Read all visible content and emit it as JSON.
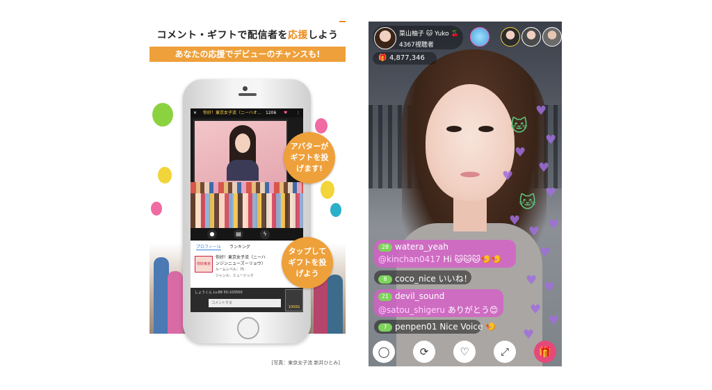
{
  "left_panel": {
    "headline_prefix": "コメント・ギフトで配信者を",
    "headline_emphasis": "応援",
    "headline_suffix": "しよう",
    "band_text": "あなたの応援でデビューのチャンスも!",
    "caption": "[写真：東京女子流 新井ひとみ]",
    "bubble_1": "アバターがギフトを投げます!",
    "bubble_2": "タップしてギフトを投げよう",
    "screen": {
      "close": "✕",
      "title": "你好！東京女子流（ニーハオ…",
      "count": "1206",
      "heart": "♥",
      "more": "⋮",
      "tab_profile": "プロフィール",
      "tab_ranking": "ランキング",
      "profile_name": "你好！東京女子流（ニーハ",
      "profile_name2": "ンジンニューズーリョウ）",
      "room_level": "ルームレベル：75",
      "genre": "ジャンル：ミュージック",
      "logo": "你好東京",
      "comment_placeholder": "コメントする",
      "stats": "しょうくん    Lv.88   50:103500",
      "gift_count": "1000G"
    }
  },
  "right_panel": {
    "host_name": "菜山柚子 🐱 Yuko 🍒",
    "viewers": "4367視聴者",
    "gift_icon": "🎁",
    "gift_total": "4,877,346",
    "chats": [
      {
        "level": "28",
        "user": "watera_yeah",
        "mention": "@kinchan0417",
        "text": "Hi 🐱🐱🐱🍤🍤"
      },
      {
        "level": "8",
        "user": "coco_nice",
        "text": "いいね！"
      },
      {
        "level": "21",
        "user": "devil_sound",
        "mention": "@satou_shigeru",
        "text": "ありがとう😊"
      },
      {
        "level": "7",
        "user": "penpen01",
        "text": "Nice Voice 🍤"
      }
    ],
    "buttons": {
      "comment": "◯",
      "share": "⟳",
      "like": "♡",
      "fullscreen": "⤢",
      "gift": "🎁"
    }
  },
  "colors": {
    "accent_orange": "#eea03a",
    "chat_pink": "#d65fc8",
    "level_green": "#7ed35a"
  }
}
